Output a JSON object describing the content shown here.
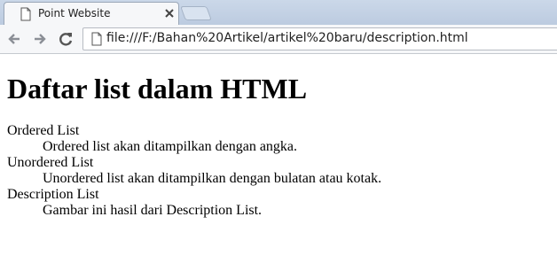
{
  "tab": {
    "title": "Point Website"
  },
  "toolbar": {
    "url": "file:///F:/Bahan%20Artikel/artikel%20baru/description.html"
  },
  "page": {
    "heading": "Daftar list dalam HTML",
    "list": [
      {
        "term": "Ordered List",
        "description": "Ordered list akan ditampilkan dengan angka."
      },
      {
        "term": "Unordered List",
        "description": "Unordered list akan ditampilkan dengan bulatan atau kotak."
      },
      {
        "term": "Description List",
        "description": "Gambar ini hasil dari Description List."
      }
    ]
  },
  "icons": {
    "tab_icon": "page-icon",
    "close": "close-icon",
    "back": "back-arrow-icon",
    "forward": "forward-arrow-icon",
    "reload": "reload-icon",
    "omnibox_icon": "page-icon"
  }
}
